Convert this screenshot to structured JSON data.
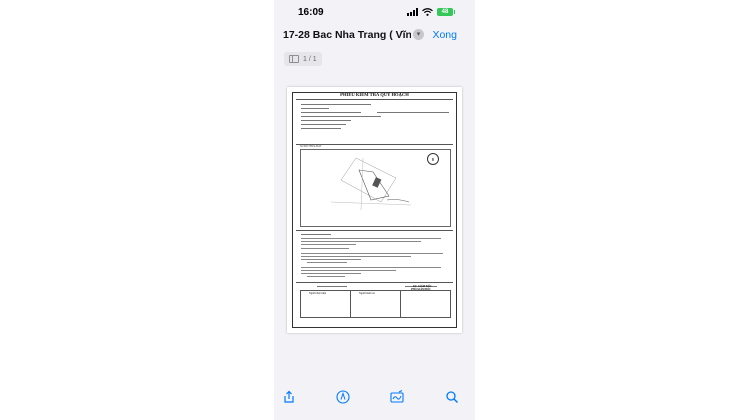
{
  "status": {
    "time": "16:09",
    "battery": "48"
  },
  "nav": {
    "title": "17-28 Bac Nha Trang ( Vĩnh...",
    "done_label": "Xong"
  },
  "page_indicator": "1 / 1",
  "document": {
    "heading": "PHIẾU KIỂM TRA QUY HOẠCH",
    "map_label": "SƠ ĐỒ THỬA ĐẤT",
    "north_label": "B",
    "footer_left": "Người thực hiện",
    "footer_mid": "Người kiểm tra",
    "footer_right_title": "KT. GIÁM ĐỐC",
    "footer_right_sub": "PHÓ GIÁM ĐỐC"
  },
  "toolbar": {
    "share_icon": "share-icon",
    "markup_icon": "markup-icon",
    "signature_icon": "signature-icon",
    "search_icon": "search-icon"
  },
  "colors": {
    "accent": "#007aff",
    "battery": "#34c759",
    "background": "#f2f2f7"
  }
}
